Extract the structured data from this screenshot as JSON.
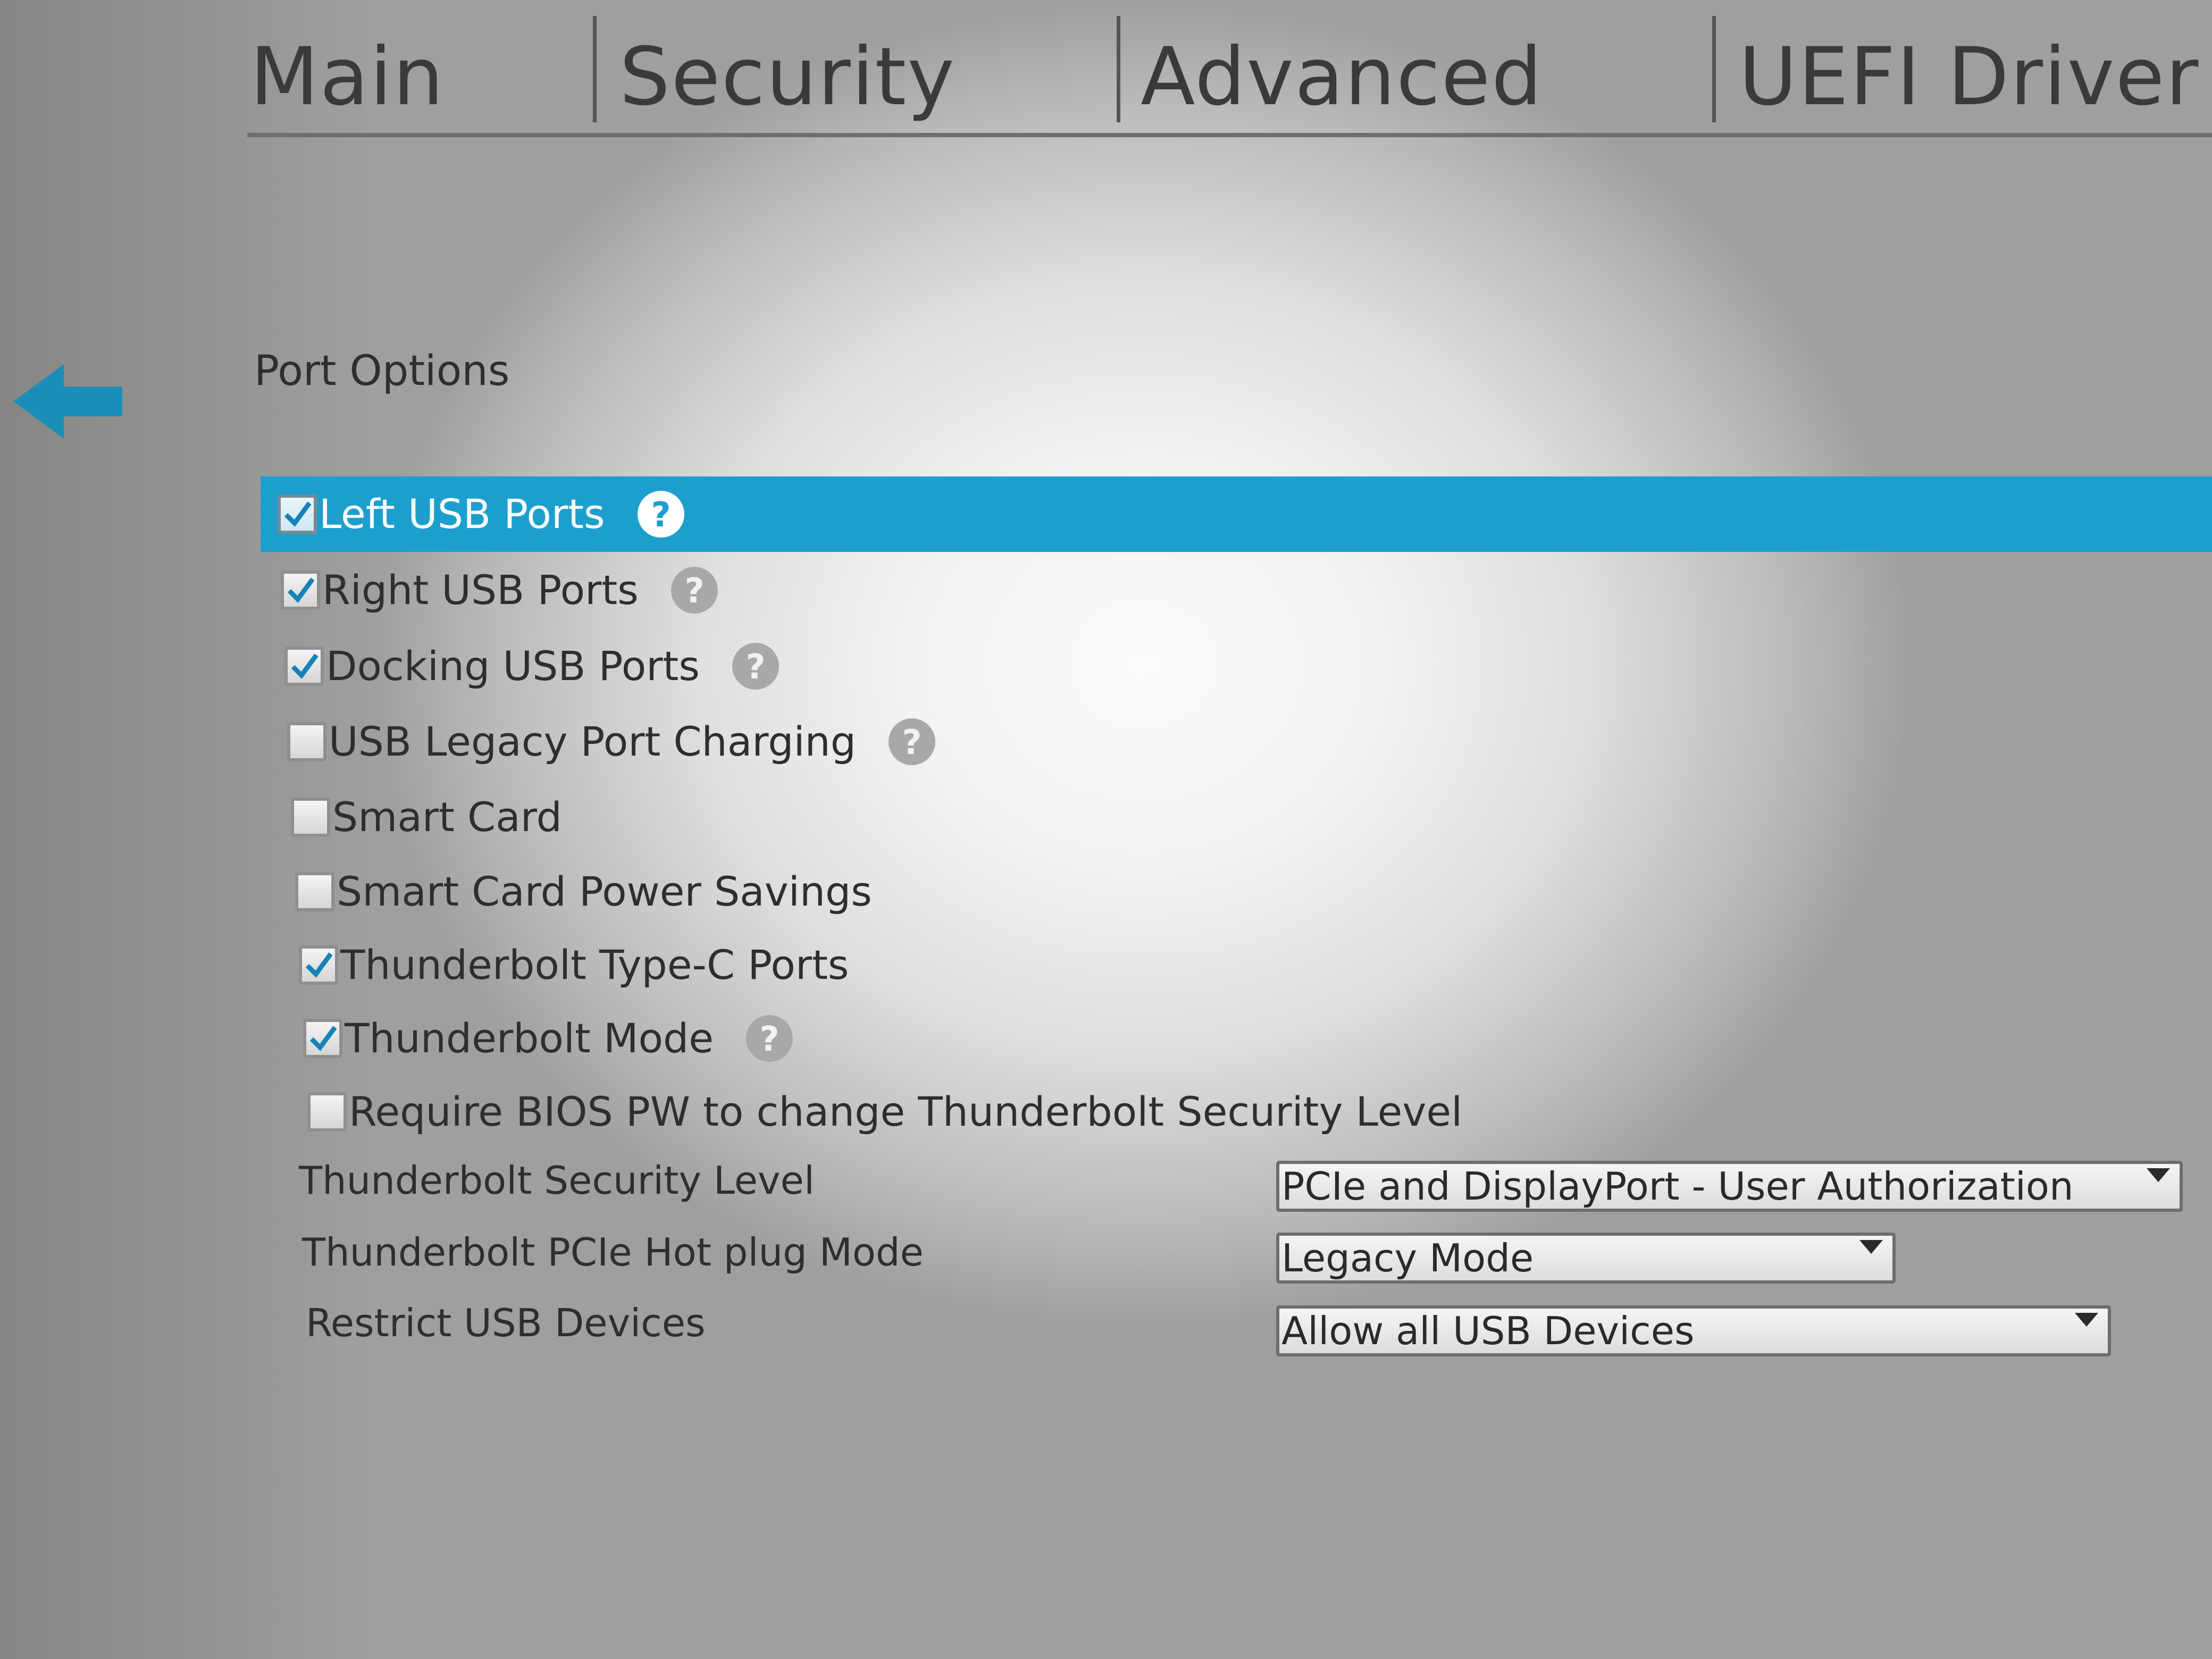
{
  "tabs": [
    {
      "label": "Main"
    },
    {
      "label": "Security"
    },
    {
      "label": "Advanced"
    },
    {
      "label": "UEFI Driver"
    }
  ],
  "page_title": "Port Options",
  "icons": {
    "back": "arrow-left-icon",
    "help": "question-mark-icon",
    "check": "checkmark-icon",
    "dropdown": "caret-down-icon"
  },
  "colors": {
    "highlight": "#1d9fce",
    "arrow": "#1b8eb8",
    "help_icon": "#a8a8a8"
  },
  "options": [
    {
      "label": "Left USB Ports",
      "checked": true,
      "help": true,
      "selected": true
    },
    {
      "label": "Right USB Ports",
      "checked": true,
      "help": true
    },
    {
      "label": "Docking USB Ports",
      "checked": true,
      "help": true
    },
    {
      "label": "USB Legacy Port Charging",
      "checked": false,
      "help": true
    },
    {
      "label": "Smart Card",
      "checked": false,
      "help": false
    },
    {
      "label": "Smart Card Power Savings",
      "checked": false,
      "help": false
    },
    {
      "label": "Thunderbolt Type-C Ports",
      "checked": true,
      "help": false
    },
    {
      "label": "Thunderbolt Mode",
      "checked": true,
      "help": true
    },
    {
      "label": "Require BIOS PW to change Thunderbolt Security Level",
      "checked": false,
      "help": false
    }
  ],
  "fields": [
    {
      "label": "Thunderbolt Security Level",
      "value": "PCIe and DisplayPort - User Authorization"
    },
    {
      "label": "Thunderbolt PCIe Hot plug Mode",
      "value": "Legacy Mode"
    },
    {
      "label": "Restrict USB Devices",
      "value": "Allow all USB Devices"
    }
  ]
}
